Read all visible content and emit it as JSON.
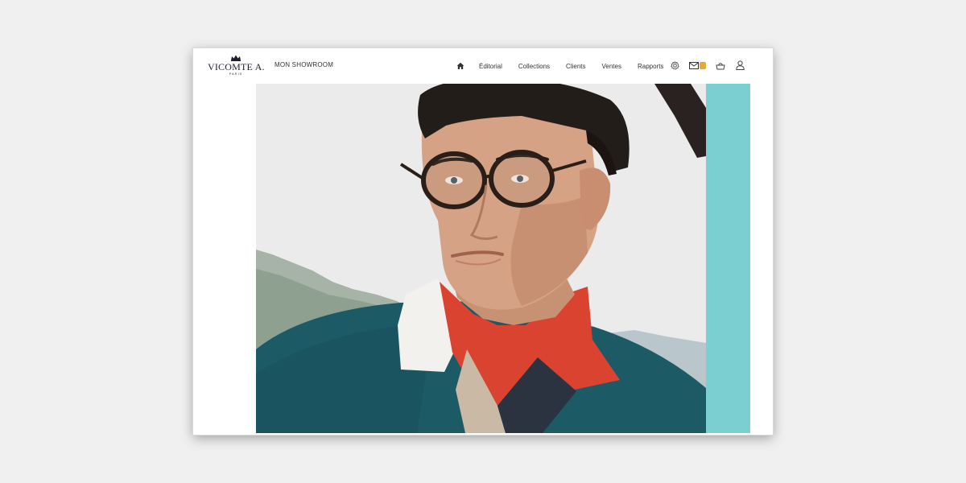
{
  "brand": {
    "name": "VICOMTE A.",
    "subline": "PARIS"
  },
  "header": {
    "showroom_label": "MON SHOWROOM",
    "nav": [
      {
        "label": "Éditorial"
      },
      {
        "label": "Collections"
      },
      {
        "label": "Clients"
      },
      {
        "label": "Ventes"
      },
      {
        "label": "Rapports"
      }
    ],
    "icons": [
      "home-icon",
      "settings-icon",
      "mail-icon",
      "notification-badge",
      "basket-icon",
      "user-icon"
    ]
  },
  "hero": {
    "subject": "photo of man wearing round tortoiseshell glasses and teal polo with red collar",
    "side_panel_color": "#7ccfd1"
  },
  "colors": {
    "accent_teal": "#7ccfd1",
    "badge_gold": "#e7a73b",
    "text_dark": "#333333",
    "sweater_teal": "#1c5a66",
    "collar_red": "#d9432f"
  }
}
